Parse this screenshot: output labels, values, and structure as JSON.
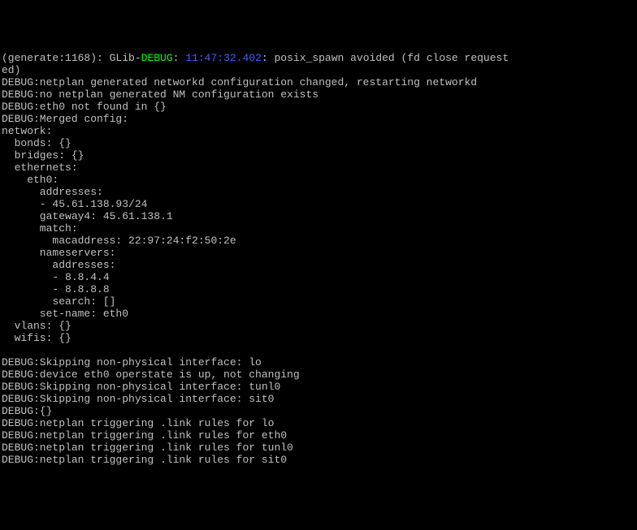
{
  "prefix": "(generate:1168): GLib-",
  "debug_label": "DEBUG",
  "colon": ": ",
  "timestamp": "11:47:32.402",
  "suffix_msg": ": posix_spawn avoided (fd close request\ned)",
  "lines": [
    "DEBUG:netplan generated networkd configuration changed, restarting networkd",
    "DEBUG:no netplan generated NM configuration exists",
    "DEBUG:eth0 not found in {}",
    "DEBUG:Merged config:",
    "network:",
    "  bonds: {}",
    "  bridges: {}",
    "  ethernets:",
    "    eth0:",
    "      addresses:",
    "      - 45.61.138.93/24",
    "      gateway4: 45.61.138.1",
    "      match:",
    "        macaddress: 22:97:24:f2:50:2e",
    "      nameservers:",
    "        addresses:",
    "        - 8.8.4.4",
    "        - 8.8.8.8",
    "        search: []",
    "      set-name: eth0",
    "  vlans: {}",
    "  wifis: {}",
    "",
    "DEBUG:Skipping non-physical interface: lo",
    "DEBUG:device eth0 operstate is up, not changing",
    "DEBUG:Skipping non-physical interface: tunl0",
    "DEBUG:Skipping non-physical interface: sit0",
    "DEBUG:{}",
    "DEBUG:netplan triggering .link rules for lo",
    "DEBUG:netplan triggering .link rules for eth0",
    "DEBUG:netplan triggering .link rules for tunl0",
    "DEBUG:netplan triggering .link rules for sit0"
  ]
}
